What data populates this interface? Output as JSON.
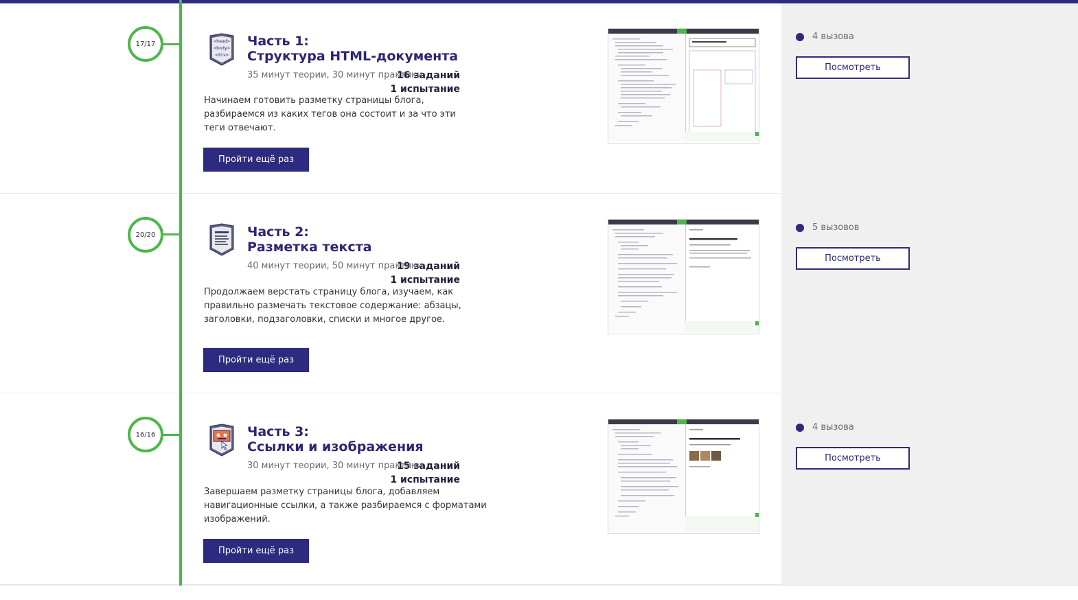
{
  "colors": {
    "accent": "#2d2b7f",
    "progress": "#4db64a",
    "sidebar_bg": "#f0f0f0"
  },
  "parts": [
    {
      "progress": "17/17",
      "tasks": "16 заданий",
      "tests": "1 испытание",
      "title_line1": "Часть 1:",
      "title_line2": "Структура HTML-документа",
      "duration": "35 минут теории, 30 минут практики",
      "description": "Начинаем готовить разметку страницы блога, разбираемся из каких тегов она состоит и за что эти теги отвечают.",
      "button": "Пройти ещё раз",
      "calls": "4 вызова",
      "view_button": "Посмотреть",
      "badge": {
        "icon": "html-tags-icon",
        "tags": [
          "<head>",
          "<body>",
          "<div>"
        ]
      }
    },
    {
      "progress": "20/20",
      "tasks": "19 заданий",
      "tests": "1 испытание",
      "title_line1": "Часть 2:",
      "title_line2": "Разметка текста",
      "duration": "40 минут теории, 50 минут практики",
      "description": "Продолжаем верстать страницу блога, изучаем, как правильно размечать текстовое содержание: абзацы, заголовки, подзаголовки, списки и многое другое.",
      "button": "Пройти ещё раз",
      "calls": "5 вызовов",
      "view_button": "Посмотреть",
      "badge": {
        "icon": "text-document-icon"
      }
    },
    {
      "progress": "16/16",
      "tasks": "15 заданий",
      "tests": "1 испытание",
      "title_line1": "Часть 3:",
      "title_line2": "Ссылки и изображения",
      "duration": "30 минут теории, 30 минут практики",
      "description": "Завершаем разметку страницы блога, добавляем навигационные ссылки, а также разбираемся с форматами изображений.",
      "button": "Пройти ещё раз",
      "calls": "4 вызова",
      "view_button": "Посмотреть",
      "badge": {
        "icon": "image-link-icon"
      }
    }
  ]
}
